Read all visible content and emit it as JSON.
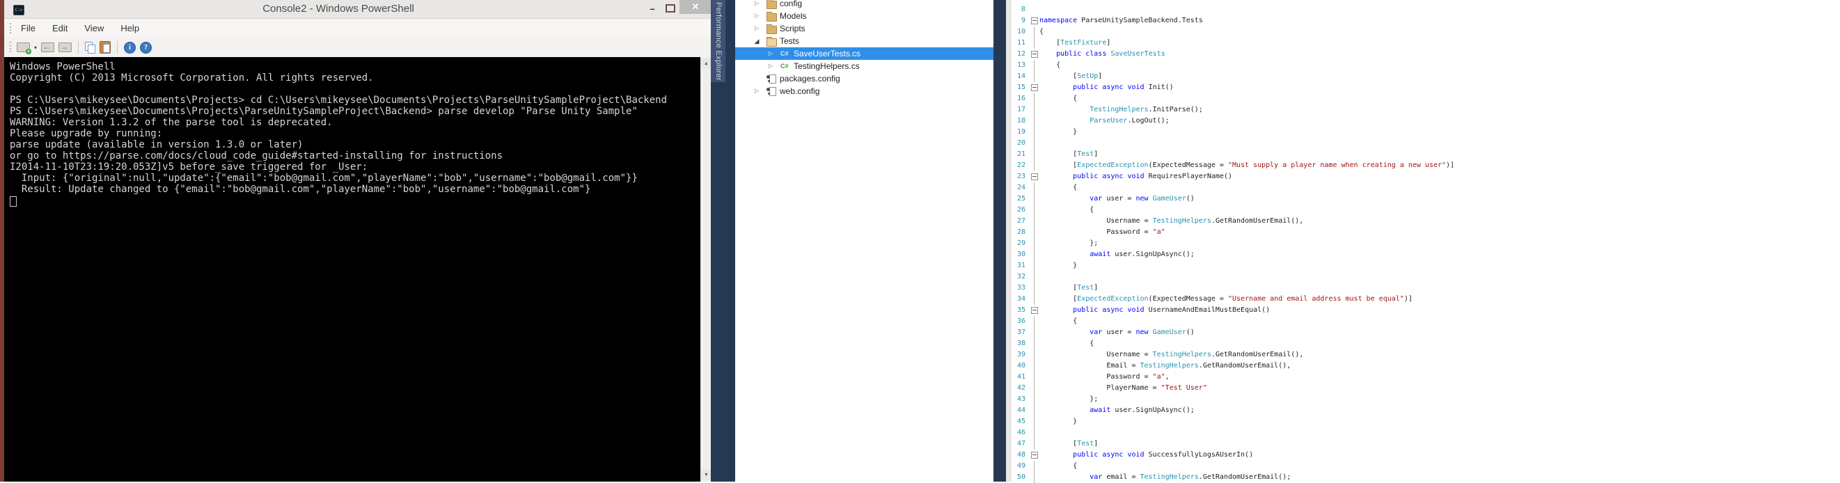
{
  "console": {
    "title": "Console2 - Windows PowerShell",
    "menu": [
      "File",
      "Edit",
      "View",
      "Help"
    ],
    "toolbar_buttons": [
      "new-console",
      "new-console-dropdown",
      "previous-console",
      "next-console",
      "separator",
      "copy",
      "paste",
      "separator",
      "info",
      "about"
    ],
    "window_buttons": {
      "minimize": "–",
      "maximize": "",
      "close": "✕"
    },
    "scrollbar": {
      "up_glyph": "▲",
      "down_glyph": "▼"
    },
    "output_lines": [
      "Windows PowerShell",
      "Copyright (C) 2013 Microsoft Corporation. All rights reserved.",
      "",
      "PS C:\\Users\\mikeysee\\Documents\\Projects> cd C:\\Users\\mikeysee\\Documents\\Projects\\ParseUnitySampleProject\\Backend",
      "PS C:\\Users\\mikeysee\\Documents\\Projects\\ParseUnitySampleProject\\Backend> parse develop \"Parse Unity Sample\"",
      "WARNING: Version 1.3.2 of the parse tool is deprecated.",
      "Please upgrade by running:",
      "parse update (available in version 1.3.0 or later)",
      "or go to https://parse.com/docs/cloud_code_guide#started-installing for instructions",
      "I2014-11-10T23:19:20.053Z]v5 before_save triggered for _User:",
      "  Input: {\"original\":null,\"update\":{\"email\":\"bob@gmail.com\",\"playerName\":\"bob\",\"username\":\"bob@gmail.com\"}}",
      "  Result: Update changed to {\"email\":\"bob@gmail.com\",\"playerName\":\"bob\",\"username\":\"bob@gmail.com\"}"
    ]
  },
  "performance_tab": {
    "label": "Performance Explorer"
  },
  "solution_explorer": {
    "items": [
      {
        "label": "config",
        "type": "folder",
        "level": 0,
        "expander": "collapsed",
        "selected": false
      },
      {
        "label": "Models",
        "type": "folder",
        "level": 0,
        "expander": "collapsed",
        "selected": false
      },
      {
        "label": "Scripts",
        "type": "folder",
        "level": 0,
        "expander": "collapsed",
        "selected": false
      },
      {
        "label": "Tests",
        "type": "folder-open",
        "level": 0,
        "expander": "expanded",
        "selected": false
      },
      {
        "label": "SaveUserTests.cs",
        "type": "csharp",
        "level": 1,
        "expander": "collapsed",
        "selected": true
      },
      {
        "label": "TestingHelpers.cs",
        "type": "csharp",
        "level": 1,
        "expander": "collapsed",
        "selected": false
      },
      {
        "label": "packages.config",
        "type": "config",
        "level": 0,
        "expander": "none",
        "selected": false
      },
      {
        "label": "web.config",
        "type": "config",
        "level": 0,
        "expander": "collapsed",
        "selected": false
      }
    ],
    "expander_glyphs": {
      "collapsed": "▷",
      "expanded": "◢"
    }
  },
  "editor": {
    "first_line": 8,
    "fold_lines": [
      9,
      12,
      15,
      23,
      35,
      48
    ],
    "lines": [
      {
        "n": 8,
        "t": []
      },
      {
        "n": 9,
        "t": [
          [
            "kw",
            "namespace"
          ],
          [
            "pl",
            " ParseUnitySampleBackend.Tests"
          ]
        ]
      },
      {
        "n": 10,
        "t": [
          [
            "pl",
            "{"
          ]
        ]
      },
      {
        "n": 11,
        "t": [
          [
            "pl",
            "    ["
          ],
          [
            "ty",
            "TestFixture"
          ],
          [
            "pl",
            "]"
          ]
        ]
      },
      {
        "n": 12,
        "t": [
          [
            "pl",
            "    "
          ],
          [
            "kw",
            "public"
          ],
          [
            "pl",
            " "
          ],
          [
            "kw",
            "class"
          ],
          [
            "pl",
            " "
          ],
          [
            "ty",
            "SaveUserTests"
          ]
        ]
      },
      {
        "n": 13,
        "t": [
          [
            "pl",
            "    {"
          ]
        ]
      },
      {
        "n": 14,
        "t": [
          [
            "pl",
            "        ["
          ],
          [
            "ty",
            "SetUp"
          ],
          [
            "pl",
            "]"
          ]
        ]
      },
      {
        "n": 15,
        "t": [
          [
            "pl",
            "        "
          ],
          [
            "kw",
            "public"
          ],
          [
            "pl",
            " "
          ],
          [
            "kw",
            "async"
          ],
          [
            "pl",
            " "
          ],
          [
            "kw",
            "void"
          ],
          [
            "pl",
            " Init()"
          ]
        ]
      },
      {
        "n": 16,
        "t": [
          [
            "pl",
            "        {"
          ]
        ]
      },
      {
        "n": 17,
        "t": [
          [
            "pl",
            "            "
          ],
          [
            "ty",
            "TestingHelpers"
          ],
          [
            "pl",
            ".InitParse();"
          ]
        ]
      },
      {
        "n": 18,
        "t": [
          [
            "pl",
            "            "
          ],
          [
            "ty",
            "ParseUser"
          ],
          [
            "pl",
            ".LogOut();"
          ]
        ]
      },
      {
        "n": 19,
        "t": [
          [
            "pl",
            "        }"
          ]
        ]
      },
      {
        "n": 20,
        "t": []
      },
      {
        "n": 21,
        "t": [
          [
            "pl",
            "        ["
          ],
          [
            "ty",
            "Test"
          ],
          [
            "pl",
            "]"
          ]
        ]
      },
      {
        "n": 22,
        "t": [
          [
            "pl",
            "        ["
          ],
          [
            "ty",
            "ExpectedException"
          ],
          [
            "pl",
            "(ExpectedMessage = "
          ],
          [
            "str",
            "\"Must supply a player name when creating a new user\""
          ],
          [
            "pl",
            ")]"
          ]
        ]
      },
      {
        "n": 23,
        "t": [
          [
            "pl",
            "        "
          ],
          [
            "kw",
            "public"
          ],
          [
            "pl",
            " "
          ],
          [
            "kw",
            "async"
          ],
          [
            "pl",
            " "
          ],
          [
            "kw",
            "void"
          ],
          [
            "pl",
            " RequiresPlayerName()"
          ]
        ]
      },
      {
        "n": 24,
        "t": [
          [
            "pl",
            "        {"
          ]
        ]
      },
      {
        "n": 25,
        "t": [
          [
            "pl",
            "            "
          ],
          [
            "kw",
            "var"
          ],
          [
            "pl",
            " user = "
          ],
          [
            "kw",
            "new"
          ],
          [
            "pl",
            " "
          ],
          [
            "ty",
            "GameUser"
          ],
          [
            "pl",
            "()"
          ]
        ]
      },
      {
        "n": 26,
        "t": [
          [
            "pl",
            "            {"
          ]
        ]
      },
      {
        "n": 27,
        "t": [
          [
            "pl",
            "                Username = "
          ],
          [
            "ty",
            "TestingHelpers"
          ],
          [
            "pl",
            ".GetRandomUserEmail(),"
          ]
        ]
      },
      {
        "n": 28,
        "t": [
          [
            "pl",
            "                Password = "
          ],
          [
            "str",
            "\"a\""
          ]
        ]
      },
      {
        "n": 29,
        "t": [
          [
            "pl",
            "            };"
          ]
        ]
      },
      {
        "n": 30,
        "t": [
          [
            "pl",
            "            "
          ],
          [
            "kw",
            "await"
          ],
          [
            "pl",
            " user.SignUpAsync();"
          ]
        ]
      },
      {
        "n": 31,
        "t": [
          [
            "pl",
            "        }"
          ]
        ]
      },
      {
        "n": 32,
        "t": []
      },
      {
        "n": 33,
        "t": [
          [
            "pl",
            "        ["
          ],
          [
            "ty",
            "Test"
          ],
          [
            "pl",
            "]"
          ]
        ]
      },
      {
        "n": 34,
        "t": [
          [
            "pl",
            "        ["
          ],
          [
            "ty",
            "ExpectedException"
          ],
          [
            "pl",
            "(ExpectedMessage = "
          ],
          [
            "str",
            "\"Username and email address must be equal\""
          ],
          [
            "pl",
            ")]"
          ]
        ]
      },
      {
        "n": 35,
        "t": [
          [
            "pl",
            "        "
          ],
          [
            "kw",
            "public"
          ],
          [
            "pl",
            " "
          ],
          [
            "kw",
            "async"
          ],
          [
            "pl",
            " "
          ],
          [
            "kw",
            "void"
          ],
          [
            "pl",
            " UsernameAndEmailMustBeEqual()"
          ]
        ]
      },
      {
        "n": 36,
        "t": [
          [
            "pl",
            "        {"
          ]
        ]
      },
      {
        "n": 37,
        "t": [
          [
            "pl",
            "            "
          ],
          [
            "kw",
            "var"
          ],
          [
            "pl",
            " user = "
          ],
          [
            "kw",
            "new"
          ],
          [
            "pl",
            " "
          ],
          [
            "ty",
            "GameUser"
          ],
          [
            "pl",
            "()"
          ]
        ]
      },
      {
        "n": 38,
        "t": [
          [
            "pl",
            "            {"
          ]
        ]
      },
      {
        "n": 39,
        "t": [
          [
            "pl",
            "                Username = "
          ],
          [
            "ty",
            "TestingHelpers"
          ],
          [
            "pl",
            ".GetRandomUserEmail(),"
          ]
        ]
      },
      {
        "n": 40,
        "t": [
          [
            "pl",
            "                Email = "
          ],
          [
            "ty",
            "TestingHelpers"
          ],
          [
            "pl",
            ".GetRandomUserEmail(),"
          ]
        ]
      },
      {
        "n": 41,
        "t": [
          [
            "pl",
            "                Password = "
          ],
          [
            "str",
            "\"a\""
          ],
          [
            "pl",
            ","
          ]
        ]
      },
      {
        "n": 42,
        "t": [
          [
            "pl",
            "                PlayerName = "
          ],
          [
            "str",
            "\"Test User\""
          ]
        ]
      },
      {
        "n": 43,
        "t": [
          [
            "pl",
            "            };"
          ]
        ]
      },
      {
        "n": 44,
        "t": [
          [
            "pl",
            "            "
          ],
          [
            "kw",
            "await"
          ],
          [
            "pl",
            " user.SignUpAsync();"
          ]
        ]
      },
      {
        "n": 45,
        "t": [
          [
            "pl",
            "        }"
          ]
        ]
      },
      {
        "n": 46,
        "t": []
      },
      {
        "n": 47,
        "t": [
          [
            "pl",
            "        ["
          ],
          [
            "ty",
            "Test"
          ],
          [
            "pl",
            "]"
          ]
        ]
      },
      {
        "n": 48,
        "t": [
          [
            "pl",
            "        "
          ],
          [
            "kw",
            "public"
          ],
          [
            "pl",
            " "
          ],
          [
            "kw",
            "async"
          ],
          [
            "pl",
            " "
          ],
          [
            "kw",
            "void"
          ],
          [
            "pl",
            " SuccessfullyLogsAUserIn()"
          ]
        ]
      },
      {
        "n": 49,
        "t": [
          [
            "pl",
            "        {"
          ]
        ]
      },
      {
        "n": 50,
        "t": [
          [
            "pl",
            "            "
          ],
          [
            "kw",
            "var"
          ],
          [
            "pl",
            " email = "
          ],
          [
            "ty",
            "TestingHelpers"
          ],
          [
            "pl",
            ".GetRandomUserEmail();"
          ]
        ]
      }
    ]
  },
  "colors": {
    "keyword": "#0000ff",
    "type": "#2b91af",
    "string": "#a31515",
    "line_number": "#2b91af",
    "selection_blue": "#2f8fe8",
    "vs_edge_navy": "#273853",
    "console_frame_maroon": "#7e3d33",
    "console_text": "#d6d6d6",
    "folder_tan": "#dcb269"
  }
}
